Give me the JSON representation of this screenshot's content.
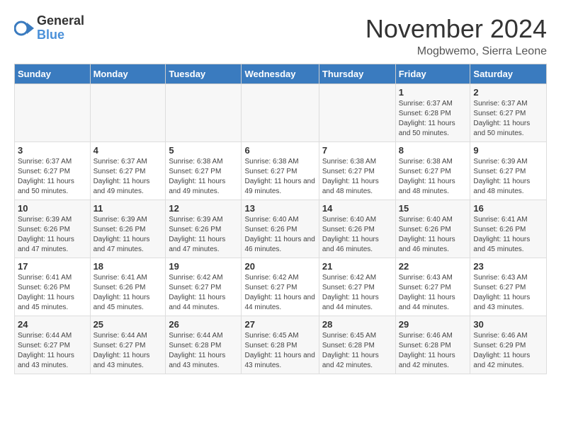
{
  "logo": {
    "general": "General",
    "blue": "Blue"
  },
  "header": {
    "month_title": "November 2024",
    "location": "Mogbwemo, Sierra Leone"
  },
  "weekdays": [
    "Sunday",
    "Monday",
    "Tuesday",
    "Wednesday",
    "Thursday",
    "Friday",
    "Saturday"
  ],
  "weeks": [
    [
      {
        "day": "",
        "info": ""
      },
      {
        "day": "",
        "info": ""
      },
      {
        "day": "",
        "info": ""
      },
      {
        "day": "",
        "info": ""
      },
      {
        "day": "",
        "info": ""
      },
      {
        "day": "1",
        "info": "Sunrise: 6:37 AM\nSunset: 6:28 PM\nDaylight: 11 hours and 50 minutes."
      },
      {
        "day": "2",
        "info": "Sunrise: 6:37 AM\nSunset: 6:27 PM\nDaylight: 11 hours and 50 minutes."
      }
    ],
    [
      {
        "day": "3",
        "info": "Sunrise: 6:37 AM\nSunset: 6:27 PM\nDaylight: 11 hours and 50 minutes."
      },
      {
        "day": "4",
        "info": "Sunrise: 6:37 AM\nSunset: 6:27 PM\nDaylight: 11 hours and 49 minutes."
      },
      {
        "day": "5",
        "info": "Sunrise: 6:38 AM\nSunset: 6:27 PM\nDaylight: 11 hours and 49 minutes."
      },
      {
        "day": "6",
        "info": "Sunrise: 6:38 AM\nSunset: 6:27 PM\nDaylight: 11 hours and 49 minutes."
      },
      {
        "day": "7",
        "info": "Sunrise: 6:38 AM\nSunset: 6:27 PM\nDaylight: 11 hours and 48 minutes."
      },
      {
        "day": "8",
        "info": "Sunrise: 6:38 AM\nSunset: 6:27 PM\nDaylight: 11 hours and 48 minutes."
      },
      {
        "day": "9",
        "info": "Sunrise: 6:39 AM\nSunset: 6:27 PM\nDaylight: 11 hours and 48 minutes."
      }
    ],
    [
      {
        "day": "10",
        "info": "Sunrise: 6:39 AM\nSunset: 6:26 PM\nDaylight: 11 hours and 47 minutes."
      },
      {
        "day": "11",
        "info": "Sunrise: 6:39 AM\nSunset: 6:26 PM\nDaylight: 11 hours and 47 minutes."
      },
      {
        "day": "12",
        "info": "Sunrise: 6:39 AM\nSunset: 6:26 PM\nDaylight: 11 hours and 47 minutes."
      },
      {
        "day": "13",
        "info": "Sunrise: 6:40 AM\nSunset: 6:26 PM\nDaylight: 11 hours and 46 minutes."
      },
      {
        "day": "14",
        "info": "Sunrise: 6:40 AM\nSunset: 6:26 PM\nDaylight: 11 hours and 46 minutes."
      },
      {
        "day": "15",
        "info": "Sunrise: 6:40 AM\nSunset: 6:26 PM\nDaylight: 11 hours and 46 minutes."
      },
      {
        "day": "16",
        "info": "Sunrise: 6:41 AM\nSunset: 6:26 PM\nDaylight: 11 hours and 45 minutes."
      }
    ],
    [
      {
        "day": "17",
        "info": "Sunrise: 6:41 AM\nSunset: 6:26 PM\nDaylight: 11 hours and 45 minutes."
      },
      {
        "day": "18",
        "info": "Sunrise: 6:41 AM\nSunset: 6:26 PM\nDaylight: 11 hours and 45 minutes."
      },
      {
        "day": "19",
        "info": "Sunrise: 6:42 AM\nSunset: 6:27 PM\nDaylight: 11 hours and 44 minutes."
      },
      {
        "day": "20",
        "info": "Sunrise: 6:42 AM\nSunset: 6:27 PM\nDaylight: 11 hours and 44 minutes."
      },
      {
        "day": "21",
        "info": "Sunrise: 6:42 AM\nSunset: 6:27 PM\nDaylight: 11 hours and 44 minutes."
      },
      {
        "day": "22",
        "info": "Sunrise: 6:43 AM\nSunset: 6:27 PM\nDaylight: 11 hours and 44 minutes."
      },
      {
        "day": "23",
        "info": "Sunrise: 6:43 AM\nSunset: 6:27 PM\nDaylight: 11 hours and 43 minutes."
      }
    ],
    [
      {
        "day": "24",
        "info": "Sunrise: 6:44 AM\nSunset: 6:27 PM\nDaylight: 11 hours and 43 minutes."
      },
      {
        "day": "25",
        "info": "Sunrise: 6:44 AM\nSunset: 6:27 PM\nDaylight: 11 hours and 43 minutes."
      },
      {
        "day": "26",
        "info": "Sunrise: 6:44 AM\nSunset: 6:28 PM\nDaylight: 11 hours and 43 minutes."
      },
      {
        "day": "27",
        "info": "Sunrise: 6:45 AM\nSunset: 6:28 PM\nDaylight: 11 hours and 43 minutes."
      },
      {
        "day": "28",
        "info": "Sunrise: 6:45 AM\nSunset: 6:28 PM\nDaylight: 11 hours and 42 minutes."
      },
      {
        "day": "29",
        "info": "Sunrise: 6:46 AM\nSunset: 6:28 PM\nDaylight: 11 hours and 42 minutes."
      },
      {
        "day": "30",
        "info": "Sunrise: 6:46 AM\nSunset: 6:29 PM\nDaylight: 11 hours and 42 minutes."
      }
    ]
  ]
}
